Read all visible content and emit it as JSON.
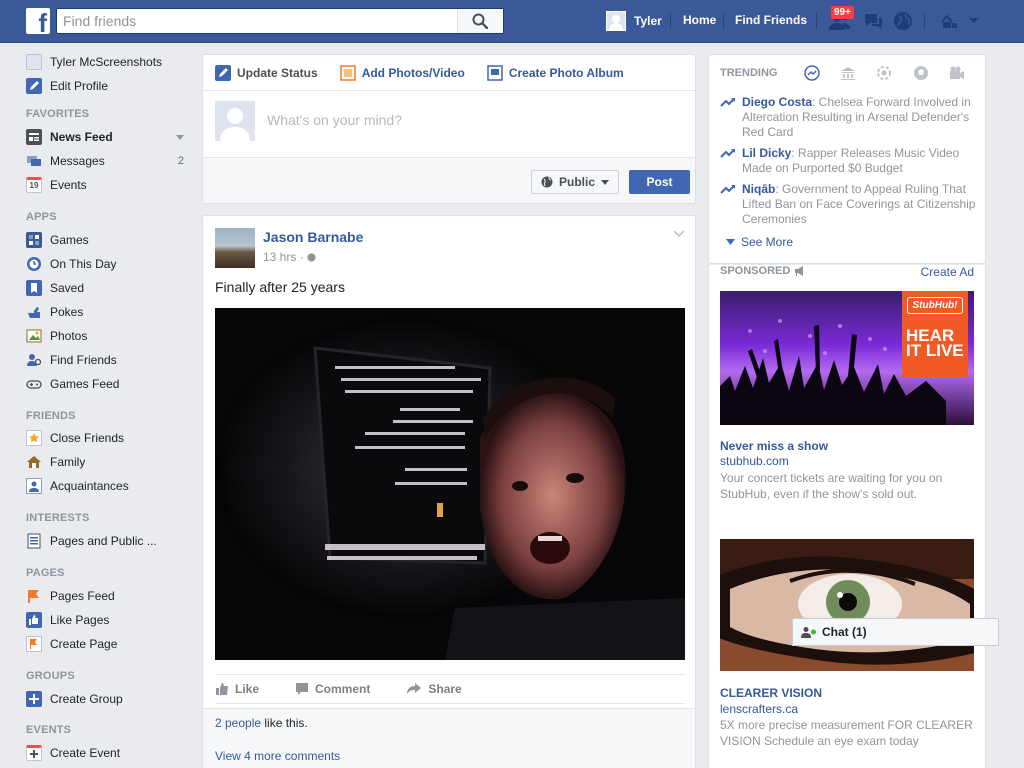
{
  "topbar": {
    "logo": "f",
    "search_placeholder": "Find friends",
    "user_name": "Tyler",
    "home": "Home",
    "find_friends": "Find Friends",
    "friend_requests_badge": "99+"
  },
  "left_nav": {
    "profile_name": "Tyler McScreenshots",
    "edit_profile": "Edit Profile",
    "favorites_header": "FAVORITES",
    "news_feed": "News Feed",
    "messages": "Messages",
    "messages_count": "2",
    "events": "Events",
    "events_icon_day": "19",
    "apps_header": "APPS",
    "games": "Games",
    "on_this_day": "On This Day",
    "saved": "Saved",
    "pokes": "Pokes",
    "photos": "Photos",
    "find_friends": "Find Friends",
    "games_feed": "Games Feed",
    "friends_header": "FRIENDS",
    "close_friends": "Close Friends",
    "family": "Family",
    "acquaintances": "Acquaintances",
    "interests_header": "INTERESTS",
    "pages_and_public": "Pages and Public ...",
    "pages_header": "PAGES",
    "pages_feed": "Pages Feed",
    "like_pages": "Like Pages",
    "create_page": "Create Page",
    "groups_header": "GROUPS",
    "create_group": "Create Group",
    "events_header": "EVENTS",
    "create_event": "Create Event"
  },
  "composer": {
    "tab_status": "Update Status",
    "tab_photos": "Add Photos/Video",
    "tab_album": "Create Photo Album",
    "placeholder": "What's on your mind?",
    "privacy": "Public",
    "post_button": "Post"
  },
  "post": {
    "author": "Jason Barnabe",
    "time": "13 hrs ·",
    "text": "Finally after 25 years",
    "like": "Like",
    "comment": "Comment",
    "share": "Share",
    "likes_link": "2 people",
    "likes_suffix": " like this.",
    "more_comments": "View 4 more comments"
  },
  "trending": {
    "header": "TRENDING",
    "items": [
      {
        "name": "Diego Costa",
        "desc": ": Chelsea Forward Involved in Altercation Resulting in Arsenal Defender's Red Card"
      },
      {
        "name": "Lil Dicky",
        "desc": ": Rapper Releases Music Video Made on Purported $0 Budget"
      },
      {
        "name": "Niqāb",
        "desc": ": Government to Appeal Ruling That Lifted Ban on Face Coverings at Citizenship Ceremonies"
      }
    ],
    "see_more": "See More"
  },
  "sponsored": {
    "header": "SPONSORED",
    "create_ad": "Create Ad",
    "ads": [
      {
        "logo": "StubHub!",
        "banner_line1": "HEAR",
        "banner_line2": "IT LIVE",
        "title": "Never miss a show",
        "url": "stubhub.com",
        "desc": "Your concert tickets are waiting for you on StubHub, even if the show's sold out."
      },
      {
        "title": "CLEARER VISION",
        "url": "lenscrafters.ca",
        "desc": "5X more precise measurement FOR CLEARER VISION Schedule an eye exam today"
      }
    ]
  },
  "chat": {
    "label": "Chat (1)"
  },
  "colors": {
    "brand_blue": "#3b5998",
    "link_blue": "#365899",
    "button_blue": "#4267b2",
    "notification_red": "#fa3e3e",
    "stubhub_orange": "#f15a24"
  }
}
